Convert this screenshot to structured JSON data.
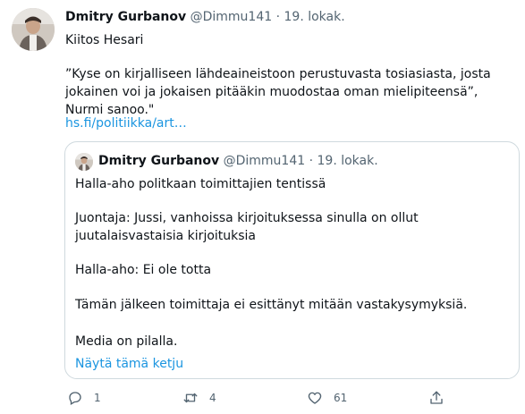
{
  "tweet": {
    "author_name": "Dmitry Gurbanov",
    "author_handle": "@Dimmu141",
    "separator": "·",
    "date": "19. lokak.",
    "text_line1": "Kiitos Hesari",
    "text_quote": "”Kyse on kirjalliseen lähdeaineistoon perustuvasta tosiasiasta, josta jokainen voi ja jokaisen pitääkin muodostaa oman mielipiteensä”, Nurmi sanoo.\"",
    "link": "hs.fi/politiikka/art…"
  },
  "quoted": {
    "author_name": "Dmitry Gurbanov",
    "author_handle": "@Dimmu141",
    "separator": "·",
    "date": "19. lokak.",
    "line1": "Halla-aho politkaan toimittajien tentissä",
    "line2": "Juontaja: Jussi, vanhoissa kirjoituksessa sinulla on ollut juutalaisvastaisia kirjoituksia",
    "line3": "Halla-aho: Ei ole totta",
    "line4": "Tämän jälkeen toimittaja ei esittänyt mitään vastakysymyksiä.",
    "line5": "Media on pilalla.",
    "show_thread": "Näytä tämä ketju"
  },
  "actions": {
    "reply_count": "1",
    "retweet_count": "4",
    "like_count": "61",
    "icons": [
      "reply-icon",
      "retweet-icon",
      "like-icon",
      "share-icon"
    ]
  }
}
